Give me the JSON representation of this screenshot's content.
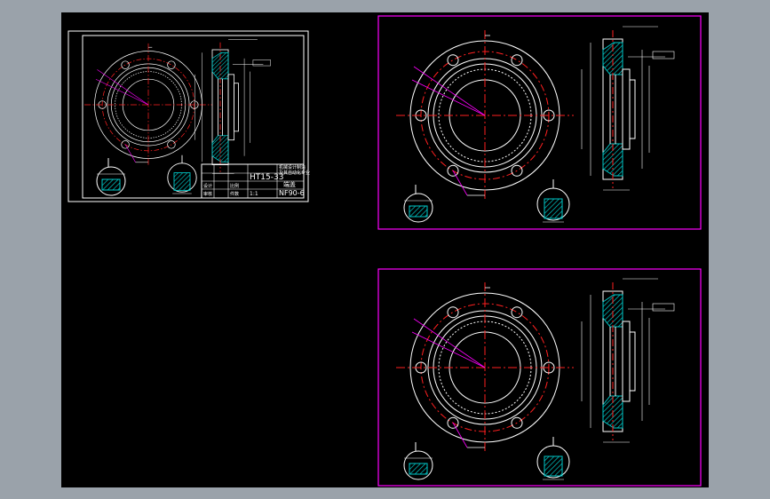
{
  "colors": {
    "frame_white": "#ffffff",
    "frame_magenta": "#ff00ff",
    "centerline": "#ff0000",
    "hatch": "#00c8c8",
    "dimension": "#ffffff",
    "background_outer": "#9aa2aa",
    "background_canvas": "#000000"
  },
  "sheet_left": {
    "title_block": {
      "material": "HT15-33",
      "part_name": "端盖",
      "drawing_no": "NF90-6",
      "scale": "1:1",
      "org_lines": [
        "机械设计制造",
        "及其自动化专业"
      ],
      "row_labels": [
        "设计",
        "审核",
        "比例",
        "件数",
        "重量",
        "共 张 第 张"
      ]
    }
  },
  "sheet_top_right": {},
  "sheet_bottom_right": {}
}
